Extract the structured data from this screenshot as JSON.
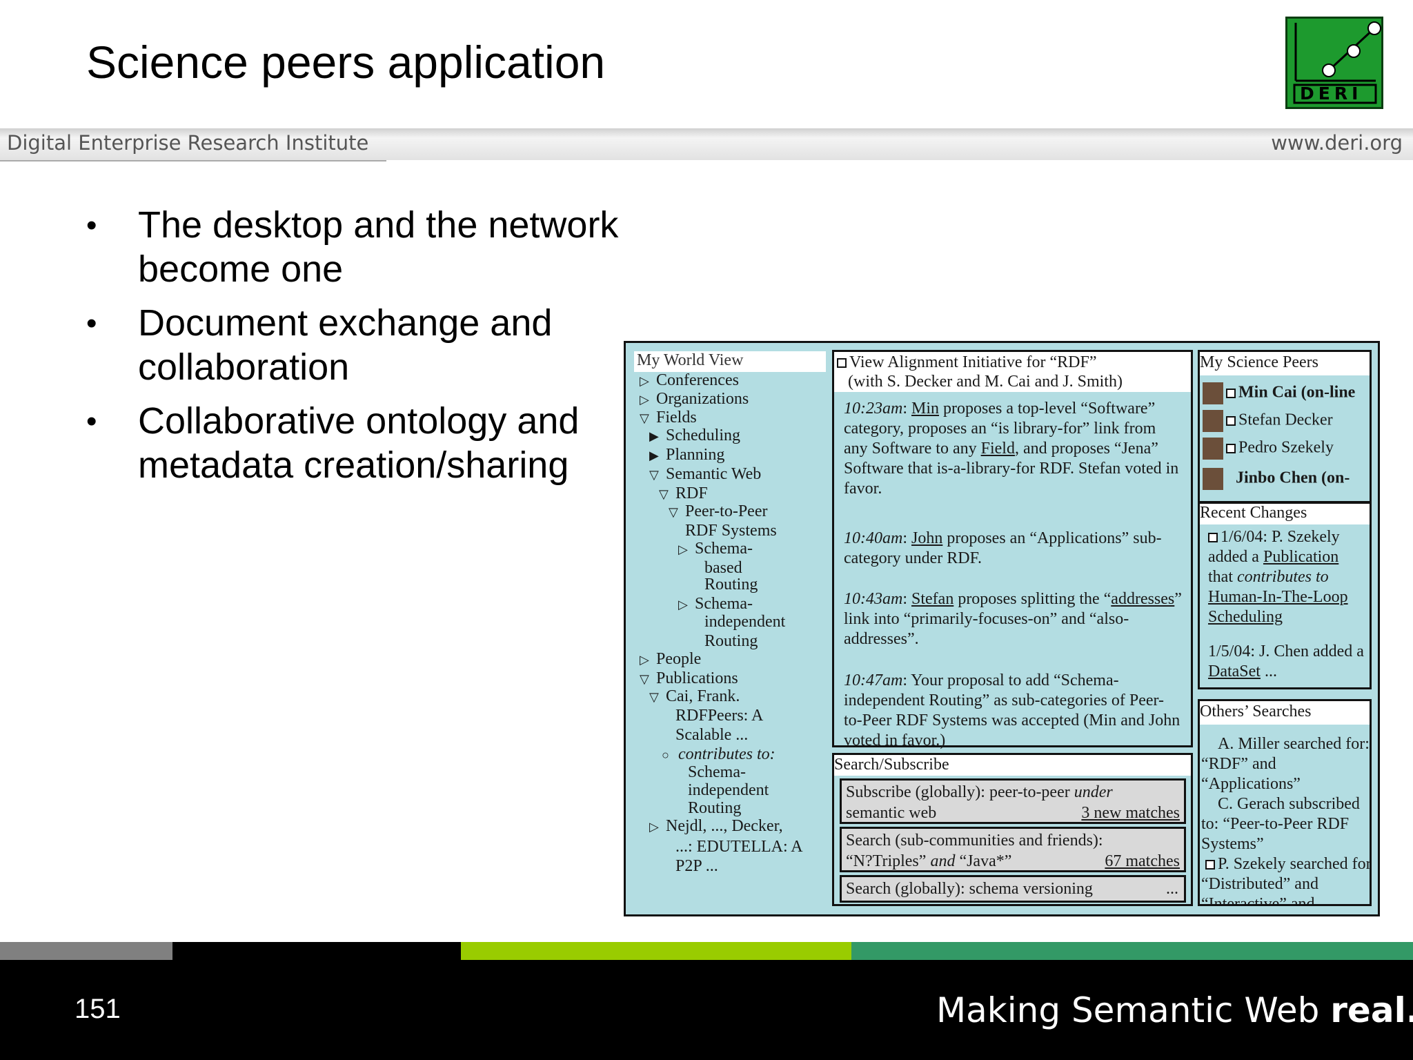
{
  "slide": {
    "title": "Science peers application",
    "institute": "Digital Enterprise Research Institute",
    "website": "www.deri.org",
    "page_number": "151",
    "tagline_prefix": "Making Semantic Web ",
    "tagline_bold": "real.",
    "logo_text": "DERI",
    "bullets": [
      "The desktop and the network become one",
      "Document exchange and collaboration",
      "Collaborative ontology and metadata creation/sharing"
    ]
  },
  "app": {
    "world_view": {
      "title": "My World View",
      "items": [
        {
          "label": "Conferences",
          "icon": "triangle-right-outline"
        },
        {
          "label": "Organizations",
          "icon": "triangle-right-outline"
        },
        {
          "label": "Fields",
          "icon": "triangle-down-outline"
        },
        {
          "label": "Scheduling",
          "icon": "triangle-right-filled"
        },
        {
          "label": "Planning",
          "icon": "triangle-right-filled"
        },
        {
          "label": "Semantic Web",
          "icon": "triangle-down-outline"
        },
        {
          "label": "RDF",
          "icon": "triangle-down-outline"
        },
        {
          "label": "Peer-to-Peer",
          "icon": "triangle-down-outline"
        },
        {
          "label": "RDF Systems",
          "icon": ""
        },
        {
          "label": "Schema-",
          "icon": "triangle-right-outline"
        },
        {
          "label": "based",
          "icon": ""
        },
        {
          "label": "Routing",
          "icon": ""
        },
        {
          "label": "Schema-",
          "icon": "triangle-right-outline"
        },
        {
          "label": "independent",
          "icon": ""
        },
        {
          "label": "Routing",
          "icon": ""
        },
        {
          "label": "People",
          "icon": "triangle-right-outline"
        },
        {
          "label": "Publications",
          "icon": "triangle-down-outline"
        },
        {
          "label": "Cai, Frank.",
          "icon": "triangle-down-outline"
        },
        {
          "label": "RDFPeers: A",
          "icon": ""
        },
        {
          "label": "Scalable ...",
          "icon": ""
        },
        {
          "label": "contributes to:",
          "icon": "circle-icon"
        },
        {
          "label": "Schema-",
          "icon": ""
        },
        {
          "label": "independent",
          "icon": ""
        },
        {
          "label": "Routing",
          "icon": ""
        },
        {
          "label": "Nejdl, ..., Decker,",
          "icon": "triangle-right-outline"
        },
        {
          "label": "...: EDUTELLA: A",
          "icon": ""
        },
        {
          "label": "P2P ...",
          "icon": ""
        }
      ]
    },
    "alignment": {
      "title": "View Alignment Initiative for “RDF”",
      "subtitle": "(with S. Decker and M. Cai and J. Smith)",
      "entries": [
        {
          "time": "10:23am",
          "person": "Min",
          "text": " proposes a top-level “Software” category, proposes an “is library-for” link from any Software to any ",
          "link": "Field",
          "text2": ", and proposes “Jena” Software that is-a-library-for RDF. Stefan voted in favor."
        },
        {
          "time": "10:40am",
          "person": "John",
          "text": " proposes an “Applications” sub-category under RDF.",
          "link": "",
          "text2": ""
        },
        {
          "time": "10:43am",
          "person": "Stefan",
          "text": " proposes splitting the “",
          "link": "addresses",
          "text2": "” link into “primarily-focuses-on” and “also-addresses”."
        },
        {
          "time": "10:47am",
          "person": "",
          "text": " Your proposal to add  “Schema-independent Routing” as sub-categories of Peer-to-Peer RDF Systems was accepted (Min and John voted in favor.)",
          "link": "",
          "text2": ""
        }
      ]
    },
    "search": {
      "title": "Search/Subscribe",
      "subscribe_text": "Subscribe (globally):  peer-to-peer ",
      "subscribe_italic": "under",
      "subscribe_text2": "semantic web",
      "subscribe_link": "3 new matches",
      "search1_text": "Search (sub-communities and friends):",
      "search1_text2a": "“N?Triples” ",
      "search1_italic": "and",
      "search1_text2b": " “Java*”",
      "search1_link": "67 matches",
      "search2_text": "Search (globally):  schema versioning",
      "search2_more": "..."
    },
    "peers": {
      "title": "My Science Peers",
      "items": [
        "Min Cai (on-line",
        "Stefan Decker",
        "Pedro Szekely",
        "Jinbo Chen (on-"
      ]
    },
    "recent": {
      "title": "Recent Changes",
      "e1_a": "1/6/04: P. Szekely added a ",
      "e1_link": "Publication",
      "e1_b": " that ",
      "e1_italic": "contributes to",
      "e1_link2": "Human-In-The-Loop Scheduling",
      "e2_a": "1/5/04: J. Chen added a ",
      "e2_link": "DataSet",
      "e2_b": " ..."
    },
    "others": {
      "title": "Others’ Searches",
      "e1": "A. Miller searched for: “RDF” and “Applications”",
      "e2": "C. Gerach subscribed to: “Peer-to-Peer RDF Systems”",
      "e3": "P. Szekely searched for “Distributed” and “Interactive” and"
    }
  },
  "colors": {
    "app_bg": "#b3dde2",
    "logo_green": "#1d9a2e",
    "stripe_gray": "#808080",
    "stripe_lime": "#99cc00",
    "stripe_green": "#339966"
  }
}
